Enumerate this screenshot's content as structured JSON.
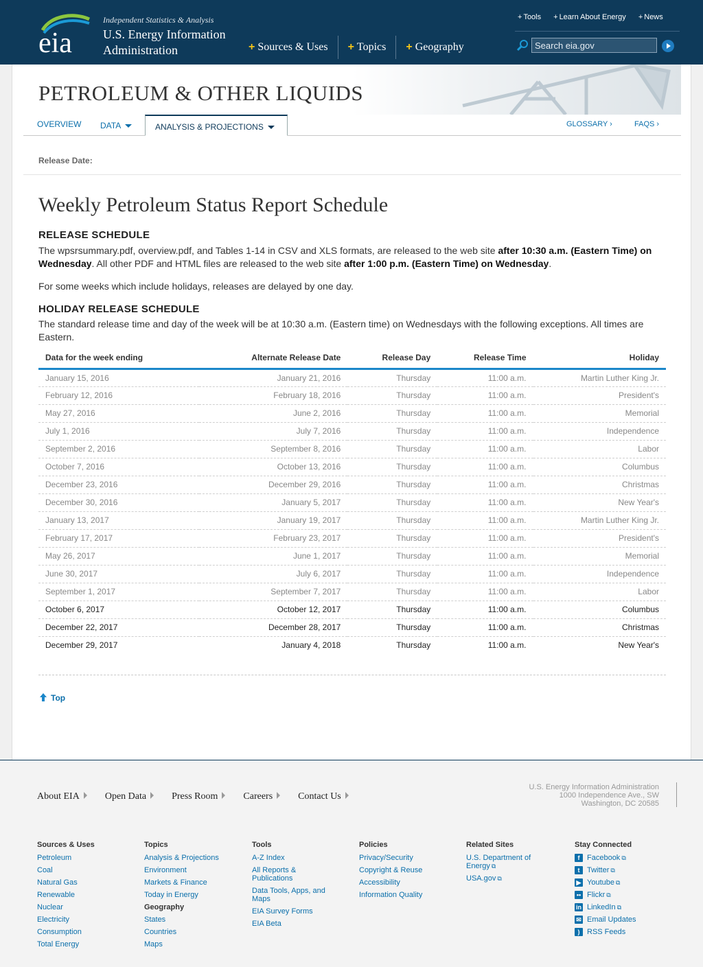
{
  "header": {
    "tagline": "Independent Statistics & Analysis",
    "agency_line1": "U.S. Energy Information",
    "agency_line2": "Administration",
    "logo_text": "eia",
    "main_nav": [
      "Sources & Uses",
      "Topics",
      "Geography"
    ],
    "util_nav": [
      "Tools",
      "Learn About Energy",
      "News"
    ],
    "search_placeholder": "Search eia.gov"
  },
  "section": {
    "title": "PETROLEUM & OTHER LIQUIDS",
    "tabs": {
      "overview": "OVERVIEW",
      "data": "DATA",
      "analysis": "ANALYSIS & PROJECTIONS",
      "glossary": "GLOSSARY ›",
      "faqs": "FAQS ›"
    },
    "release_date_label": "Release Date:"
  },
  "content": {
    "title": "Weekly Petroleum Status Report Schedule",
    "release_heading": "RELEASE SCHEDULE",
    "release_p1_a": "The wpsrsummary.pdf, overview.pdf, and Tables 1-14 in CSV and XLS formats, are released to the web site ",
    "release_p1_b": "after 10:30 a.m. (Eastern Time) on Wednesday",
    "release_p1_c": ". All other PDF and HTML files are released to the web site ",
    "release_p1_d": "after 1:00 p.m. (Eastern Time) on Wednesday",
    "release_p1_e": ".",
    "release_p2": "For some weeks which include holidays, releases are delayed by one day.",
    "holiday_heading": "HOLIDAY RELEASE SCHEDULE",
    "holiday_p": "The standard release time and day of the week will be at 10:30 a.m. (Eastern time) on Wednesdays with the following exceptions. All times are Eastern.",
    "table": {
      "headers": [
        "Data for the week ending",
        "Alternate Release Date",
        "Release Day",
        "Release Time",
        "Holiday"
      ],
      "rows": [
        [
          "January 15, 2016",
          "January 21, 2016",
          "Thursday",
          "11:00 a.m.",
          "Martin Luther King Jr."
        ],
        [
          "February 12, 2016",
          "February 18, 2016",
          "Thursday",
          "11:00 a.m.",
          "President's"
        ],
        [
          "May 27, 2016",
          "June 2, 2016",
          "Thursday",
          "11:00 a.m.",
          "Memorial"
        ],
        [
          "July 1, 2016",
          "July 7, 2016",
          "Thursday",
          "11:00 a.m.",
          "Independence"
        ],
        [
          "September 2, 2016",
          "September 8, 2016",
          "Thursday",
          "11:00 a.m.",
          "Labor"
        ],
        [
          "October 7, 2016",
          "October 13, 2016",
          "Thursday",
          "11:00 a.m.",
          "Columbus"
        ],
        [
          "December 23, 2016",
          "December 29, 2016",
          "Thursday",
          "11:00 a.m.",
          "Christmas"
        ],
        [
          "December 30, 2016",
          "January 5, 2017",
          "Thursday",
          "11:00 a.m.",
          "New Year's"
        ],
        [
          "January 13, 2017",
          "January 19, 2017",
          "Thursday",
          "11:00 a.m.",
          "Martin Luther King Jr."
        ],
        [
          "February 17, 2017",
          "February 23, 2017",
          "Thursday",
          "11:00 a.m.",
          "President's"
        ],
        [
          "May 26, 2017",
          "June 1, 2017",
          "Thursday",
          "11:00 a.m.",
          "Memorial"
        ],
        [
          "June 30, 2017",
          "July 6, 2017",
          "Thursday",
          "11:00 a.m.",
          "Independence"
        ],
        [
          "September 1, 2017",
          "September 7, 2017",
          "Thursday",
          "11:00 a.m.",
          "Labor"
        ],
        [
          "October 6, 2017",
          "October 12, 2017",
          "Thursday",
          "11:00 a.m.",
          "Columbus"
        ],
        [
          "December 22, 2017",
          "December 28, 2017",
          "Thursday",
          "11:00 a.m.",
          "Christmas"
        ],
        [
          "December 29, 2017",
          "January 4, 2018",
          "Thursday",
          "11:00 a.m.",
          "New Year's"
        ]
      ],
      "past_row_count": 13
    },
    "top_link": "Top"
  },
  "footer": {
    "nav": [
      "About EIA",
      "Open Data",
      "Press Room",
      "Careers",
      "Contact Us"
    ],
    "address": [
      "U.S. Energy Information Administration",
      "1000 Independence Ave., SW",
      "Washington, DC 20585"
    ],
    "sources": {
      "heading": "Sources & Uses",
      "links": [
        "Petroleum",
        "Coal",
        "Natural Gas",
        "Renewable",
        "Nuclear",
        "Electricity",
        "Consumption",
        "Total Energy"
      ]
    },
    "topics": {
      "heading": "Topics",
      "links": [
        "Analysis & Projections",
        "Environment",
        "Markets & Finance",
        "Today in Energy"
      ],
      "geo_heading": "Geography",
      "geo_links": [
        "States",
        "Countries",
        "Maps"
      ]
    },
    "tools": {
      "heading": "Tools",
      "links": [
        "A-Z Index",
        "All Reports & Publications",
        "Data Tools, Apps, and Maps",
        "EIA Survey Forms",
        "EIA Beta"
      ]
    },
    "policies": {
      "heading": "Policies",
      "links": [
        "Privacy/Security",
        "Copyright & Reuse",
        "Accessibility",
        "Information Quality"
      ]
    },
    "related": {
      "heading": "Related Sites",
      "links": [
        "U.S. Department of Energy",
        "USA.gov"
      ]
    },
    "social": {
      "heading": "Stay Connected",
      "links": [
        "Facebook",
        "Twitter",
        "Youtube",
        "Flickr",
        "LinkedIn",
        "Email Updates",
        "RSS Feeds"
      ]
    }
  }
}
